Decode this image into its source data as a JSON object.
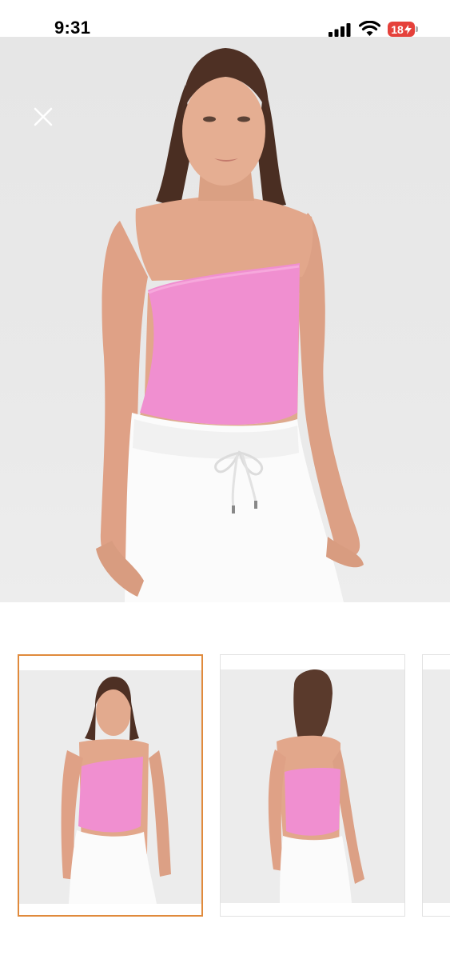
{
  "status_bar": {
    "time": "9:31",
    "battery_level": "18",
    "icons": [
      "signal-icon",
      "wifi-icon",
      "battery-icon"
    ]
  },
  "colors": {
    "top_pink": "#f08fd0",
    "pants_white": "#fbfbfb",
    "active_thumb_border": "#e08a3c",
    "battery_red": "#e5413b"
  },
  "gallery": {
    "close_icon": "close-icon",
    "selected_index": 0,
    "thumbnails": [
      "front-view",
      "back-view",
      "partial-next"
    ]
  }
}
